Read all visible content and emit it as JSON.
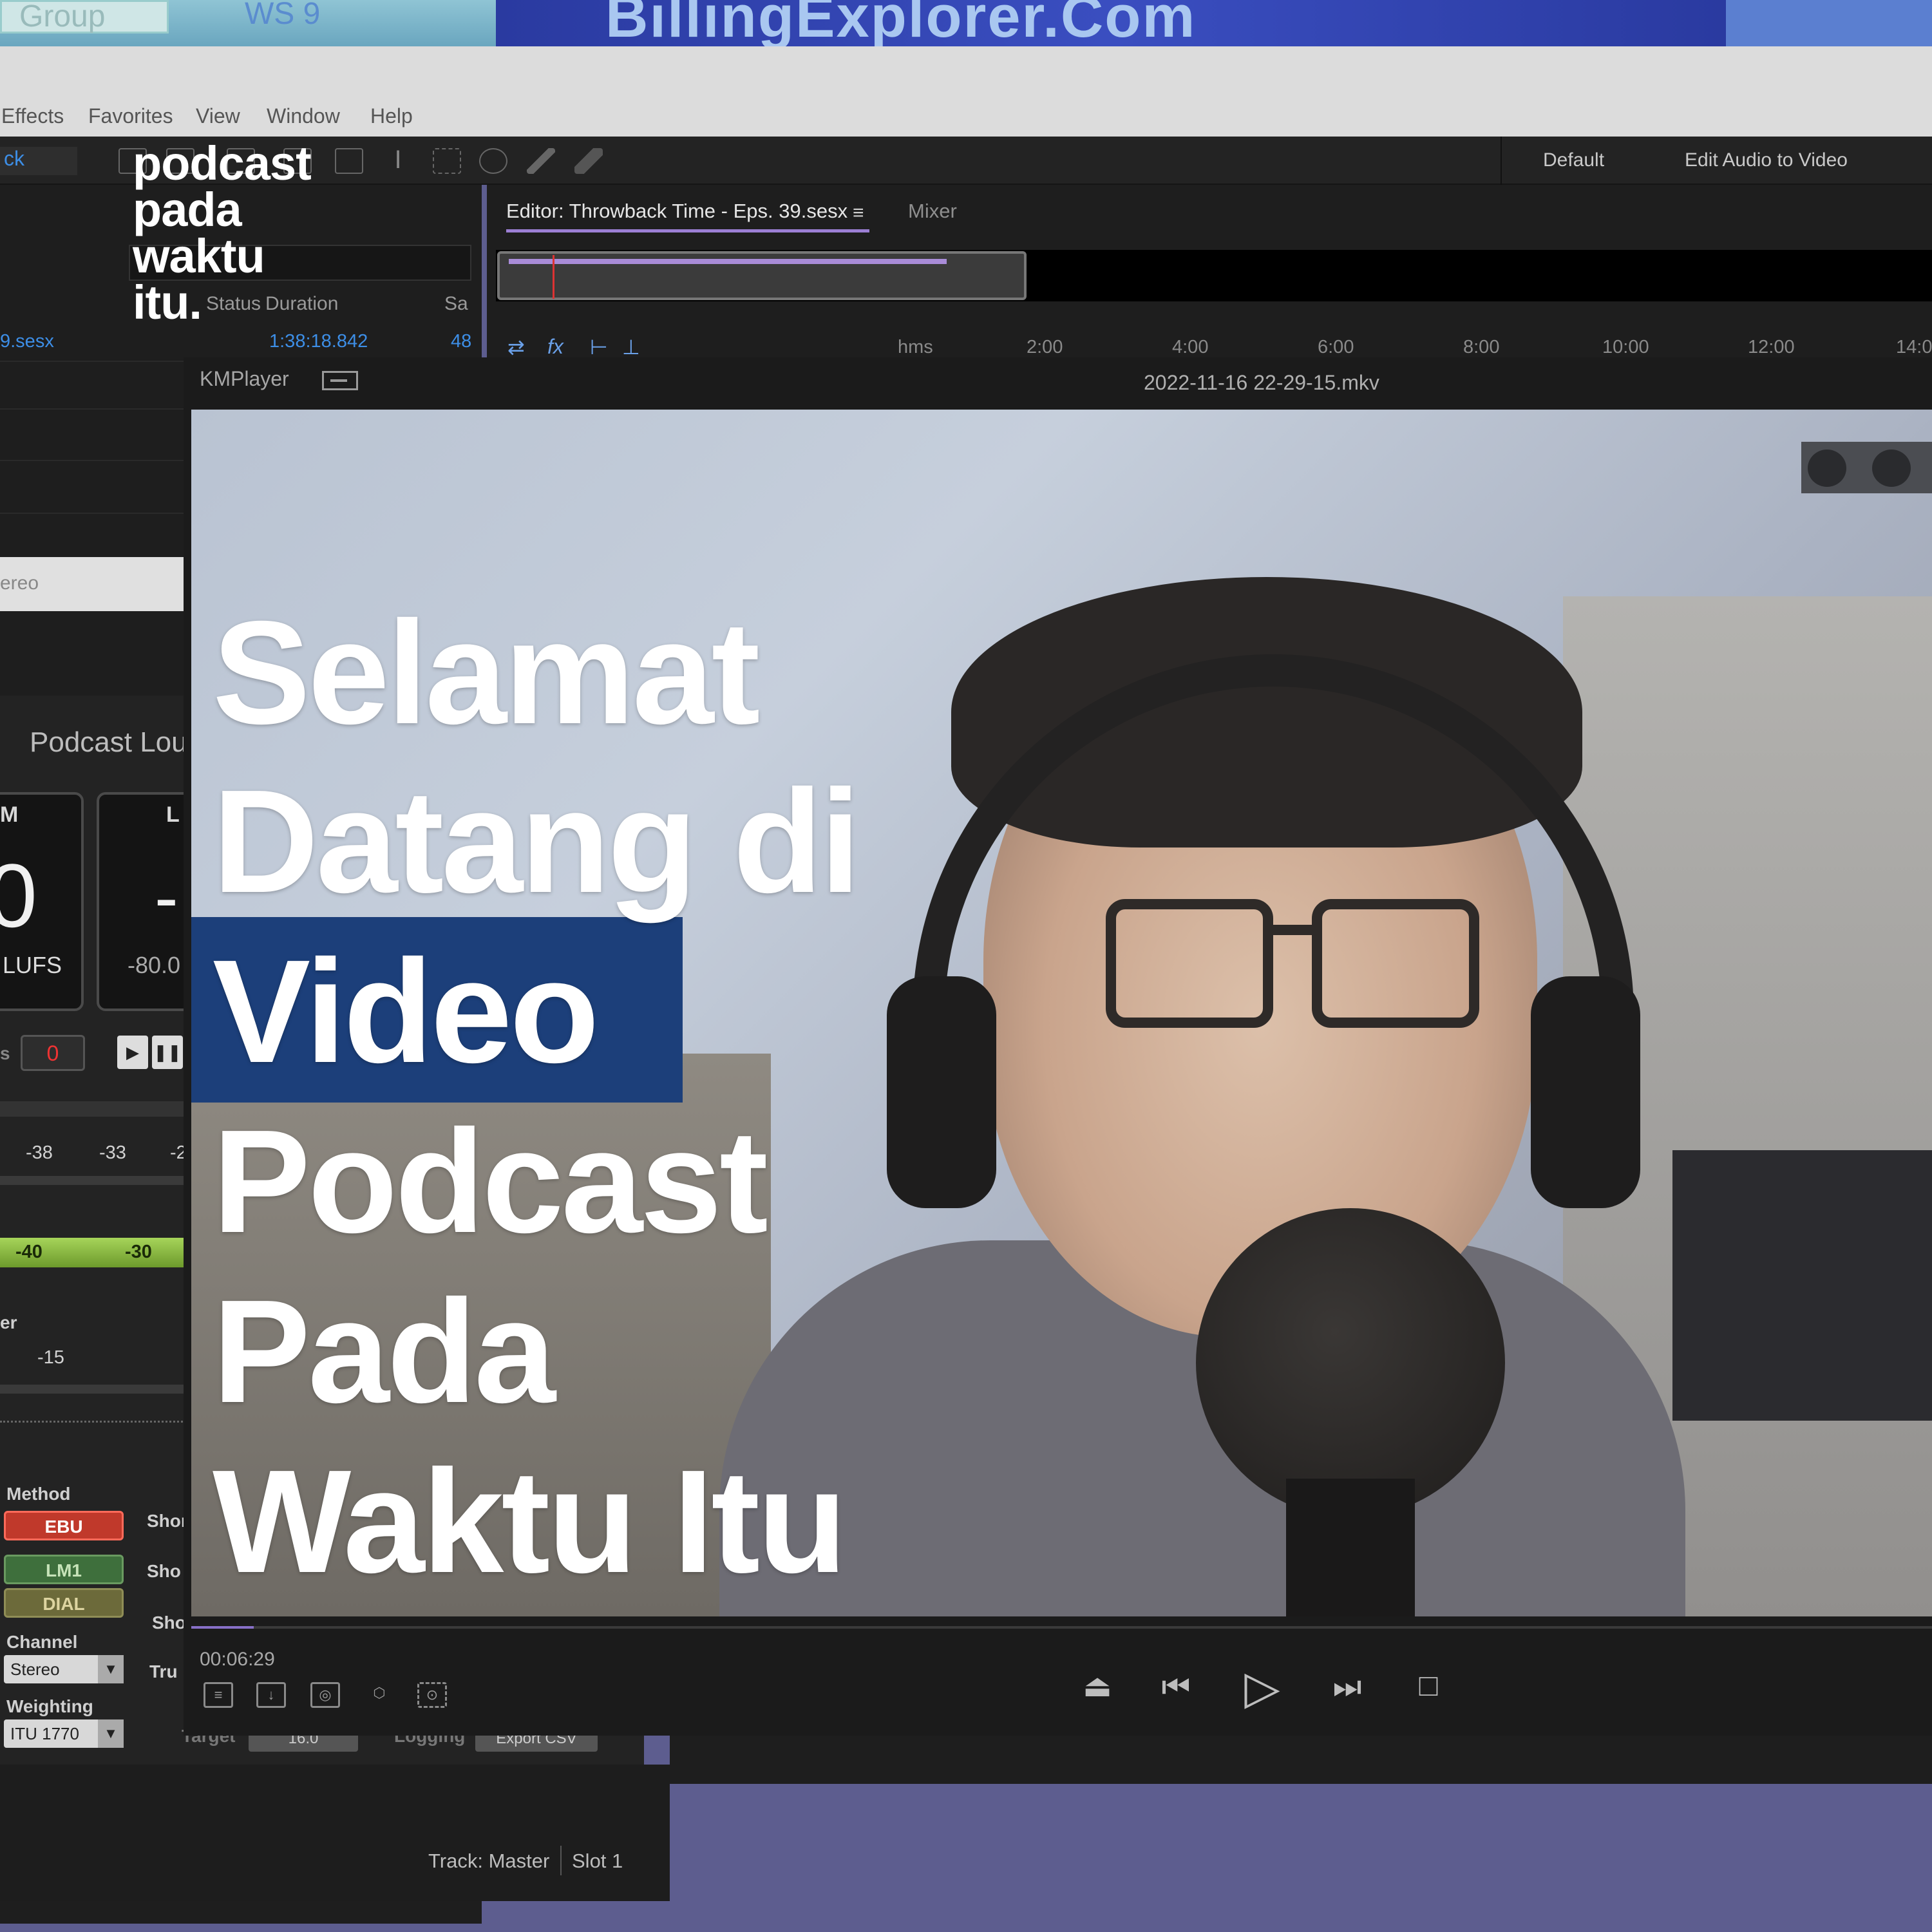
{
  "background_monitor": {
    "left_text_1": "Group",
    "left_text_2": "WS 9",
    "banner": "BillingExplorer.Com"
  },
  "audition": {
    "menu": [
      "Effects",
      "Favorites",
      "View",
      "Window",
      "Help"
    ],
    "toolbar_left_label": "ck",
    "workspaces": [
      "Default",
      "Edit Audio to Video"
    ],
    "files": {
      "columns": [
        "Status",
        "Duration",
        "Sa"
      ],
      "row": {
        "name": "9.sesx",
        "duration": "1:38:18.842",
        "sample": "48"
      }
    },
    "editor": {
      "tab_label": "Editor: Throwback Time - Eps. 39.sesx",
      "tab_menu_icon": "hamburger-icon",
      "mixer_label": "Mixer",
      "ruler": [
        "hms",
        "2:00",
        "4:00",
        "6:00",
        "8:00",
        "10:00",
        "12:00",
        "14:0"
      ]
    },
    "stereo_label": "ereo",
    "loudness": {
      "title": "Podcast Lou",
      "m_label": "M",
      "l_label": "L",
      "m_value": "0",
      "m_unit": "LUFS",
      "l_value": "-",
      "l_sub": "-80.0",
      "counter_prefix": "s",
      "counter_value": "0",
      "scale_top": [
        "-38",
        "-33",
        "-2"
      ],
      "scale_green": [
        "-40",
        "-30"
      ],
      "er_label": "er",
      "er_value": "-15",
      "method_label": "Method",
      "methods": [
        "EBU",
        "LM1",
        "DIAL"
      ],
      "short_labels": [
        "Shor",
        "Sho",
        "Sho",
        "Tru"
      ],
      "channel_label": "Channel",
      "channel_value": "Stereo",
      "weighting_label": "Weighting",
      "weighting_value": "ITU 1770",
      "target_label": "Target",
      "target_value": "16.0",
      "logging_label": "Logging",
      "export_label": "Export CSV"
    },
    "status": {
      "track": "Track: Master",
      "slot": "Slot 1"
    }
  },
  "kmplayer": {
    "app_name": "KMPlayer",
    "filename": "2022-11-16 22-29-15.mkv",
    "time": "00:06:29",
    "progress": 0.036,
    "small_buttons": [
      "playlist-icon",
      "download-icon",
      "vr-icon",
      "3d-icon",
      "capture-icon"
    ],
    "transport": [
      "eject-icon",
      "previous-icon",
      "play-icon",
      "next-icon",
      "stop-icon"
    ]
  },
  "overlay": {
    "logo_lines": [
      "podcast",
      "pada",
      "waktu",
      "itu."
    ],
    "headline_lines": [
      "Selamat",
      "Datang di",
      "Video",
      "Podcast",
      "Pada",
      "Waktu Itu"
    ],
    "highlight_color": "#1c3f7a"
  }
}
